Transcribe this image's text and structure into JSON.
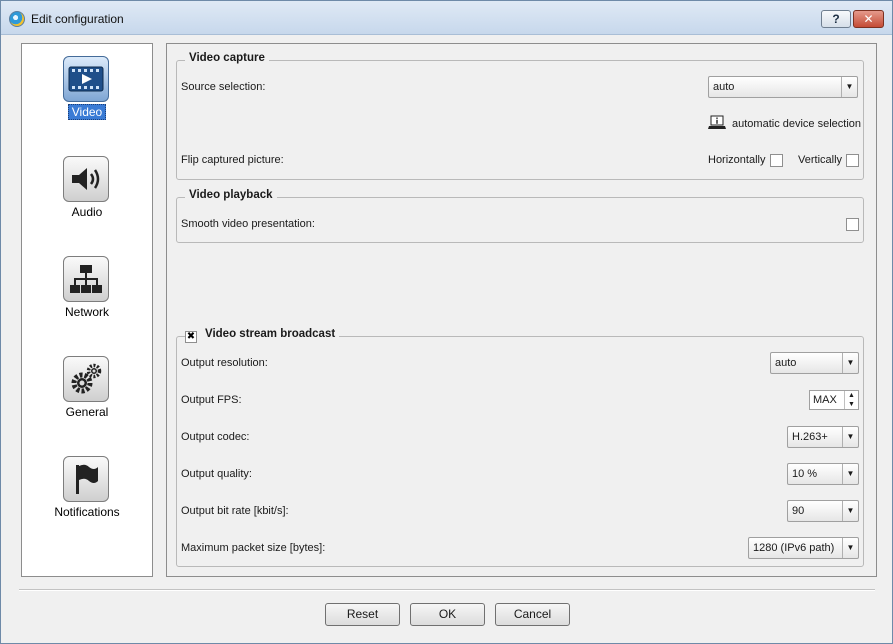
{
  "window": {
    "title": "Edit configuration",
    "help_glyph": "?",
    "close_glyph": "✕"
  },
  "sidebar": {
    "items": [
      {
        "label": "Video",
        "icon": "video-film-icon",
        "active": true
      },
      {
        "label": "Audio",
        "icon": "speaker-icon",
        "active": false
      },
      {
        "label": "Network",
        "icon": "network-icon",
        "active": false
      },
      {
        "label": "General",
        "icon": "gears-icon",
        "active": false
      },
      {
        "label": "Notifications",
        "icon": "flag-icon",
        "active": false
      }
    ]
  },
  "video_capture": {
    "title": "Video capture",
    "source_label": "Source selection:",
    "source_value": "auto",
    "auto_device_text": "automatic device selection",
    "flip_label": "Flip captured picture:",
    "horizontally_label": "Horizontally",
    "vertically_label": "Vertically"
  },
  "video_playback": {
    "title": "Video playback",
    "smooth_label": "Smooth video presentation:"
  },
  "broadcast": {
    "title": "Video stream broadcast",
    "enabled_glyph": "✖",
    "resolution_label": "Output resolution:",
    "resolution_value": "auto",
    "fps_label": "Output FPS:",
    "fps_value": "MAX",
    "codec_label": "Output codec:",
    "codec_value": "H.263+",
    "quality_label": "Output quality:",
    "quality_value": "10 %",
    "bitrate_label": "Output bit rate [kbit/s]:",
    "bitrate_value": "90",
    "packet_label": "Maximum packet size [bytes]:",
    "packet_value": "1280 (IPv6 path)"
  },
  "buttons": {
    "reset": "Reset",
    "ok": "OK",
    "cancel": "Cancel"
  },
  "colors": {
    "selection": "#3a7bd5",
    "close": "#c44b35"
  }
}
